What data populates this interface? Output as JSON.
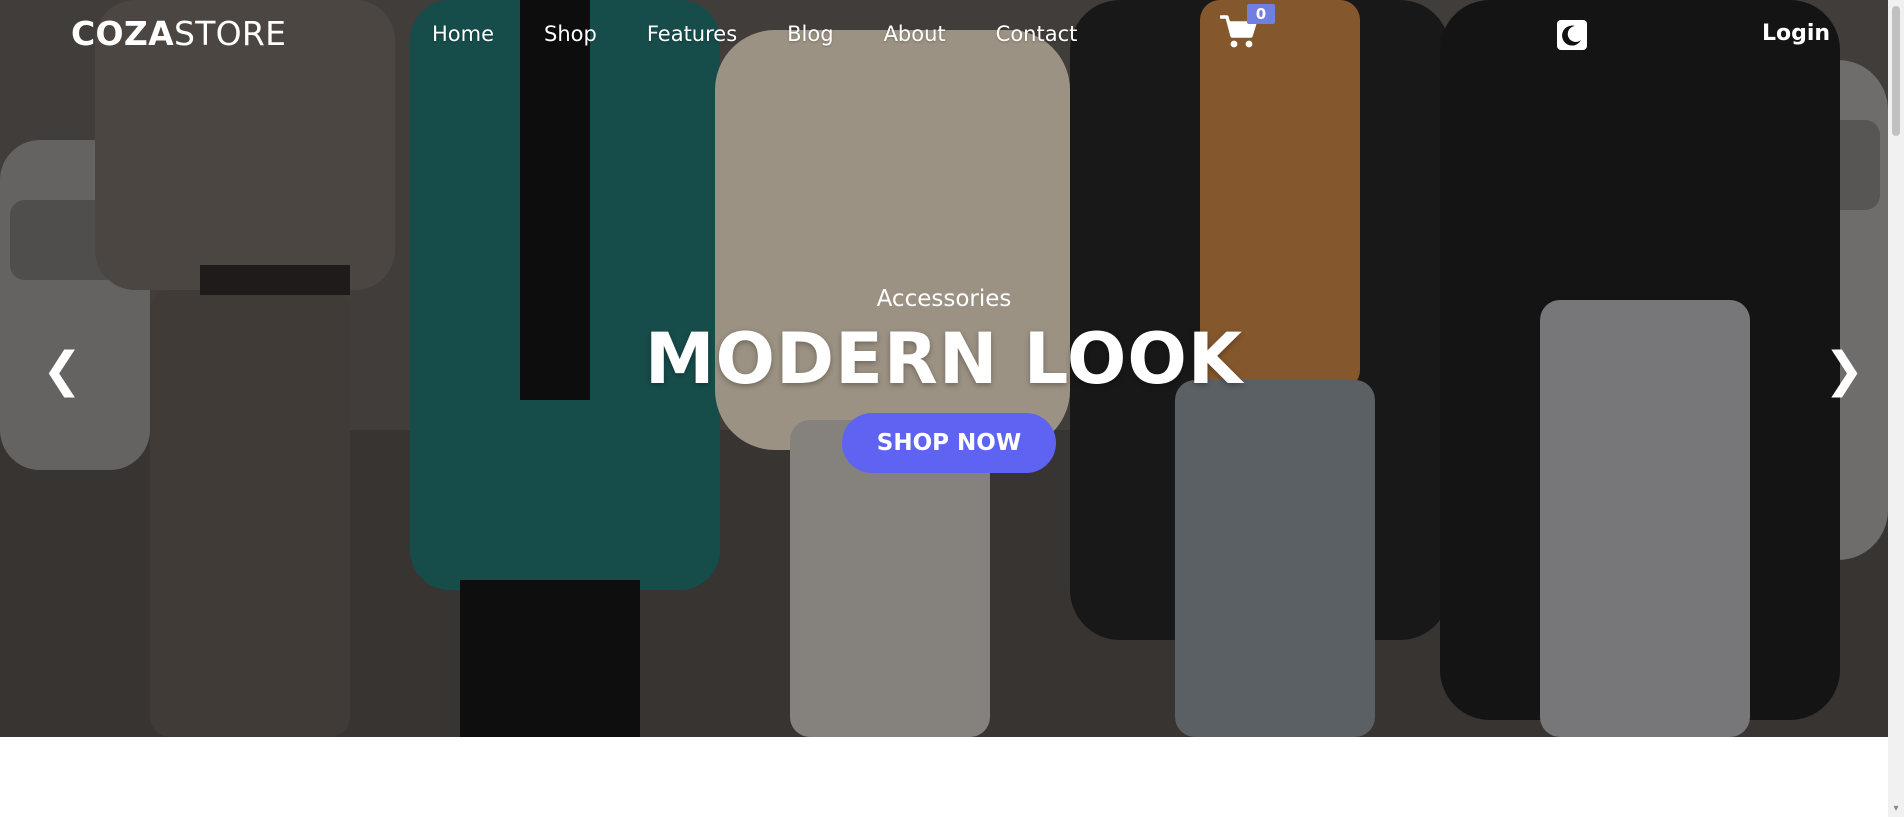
{
  "header": {
    "logo_bold": "COZA",
    "logo_light": "STORE",
    "nav": [
      "Home",
      "Shop",
      "Features",
      "Blog",
      "About",
      "Contact"
    ],
    "cart_count": "0",
    "login_label": "Login"
  },
  "slider": {
    "subtitle": "Accessories",
    "title": "MODERN LOOK",
    "button_label": "SHOP NOW",
    "prev_arrow": "❮",
    "next_arrow": "❯"
  },
  "icons": {
    "cart": "cart-icon",
    "theme": "moon-icon",
    "prev": "chevron-left-icon",
    "next": "chevron-right-icon"
  },
  "colors": {
    "accent": "#717fe0",
    "button": "#5f63f2",
    "text_on_hero": "#ffffff"
  }
}
